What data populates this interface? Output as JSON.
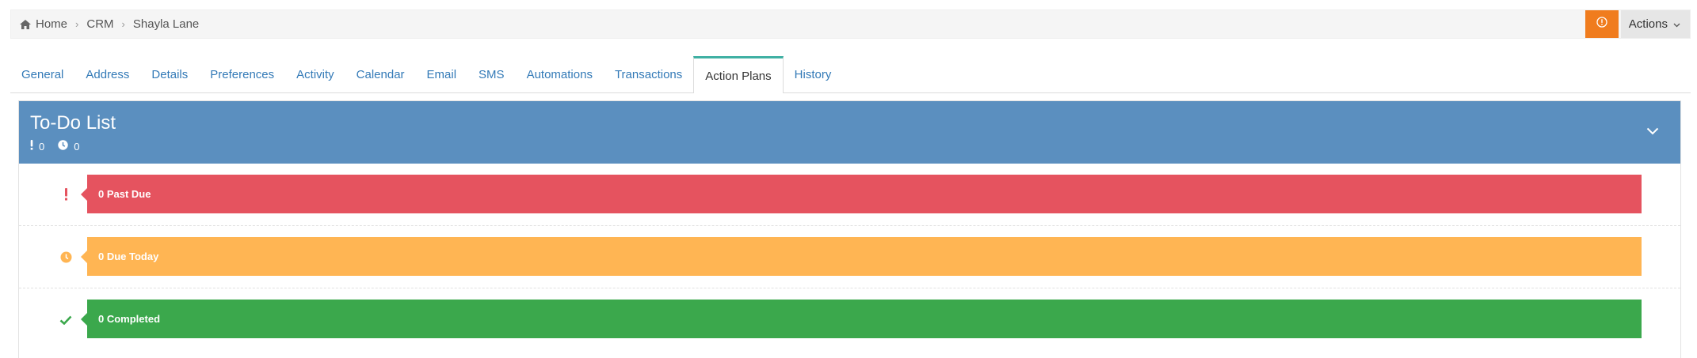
{
  "breadcrumb": {
    "home": "Home",
    "crm": "CRM",
    "current": "Shayla Lane"
  },
  "header": {
    "actions_label": "Actions"
  },
  "tabs": [
    {
      "label": "General"
    },
    {
      "label": "Address"
    },
    {
      "label": "Details"
    },
    {
      "label": "Preferences"
    },
    {
      "label": "Activity"
    },
    {
      "label": "Calendar"
    },
    {
      "label": "Email"
    },
    {
      "label": "SMS"
    },
    {
      "label": "Automations"
    },
    {
      "label": "Transactions"
    },
    {
      "label": "Action Plans",
      "active": true
    },
    {
      "label": "History"
    }
  ],
  "todo": {
    "title": "To-Do List",
    "past_due_count": "0",
    "due_today_count": "0",
    "rows": {
      "past_due": "0 Past Due",
      "due_today": "0 Due Today",
      "completed": "0 Completed"
    }
  },
  "colors": {
    "header_blue": "#5b8fbf",
    "past_due_red": "#e5535f",
    "due_today_orange": "#ffb553",
    "completed_green": "#3ba84c",
    "alert_orange": "#f07c1e",
    "tab_active_border": "#3fb0a3",
    "link_blue": "#337ab7"
  },
  "icons": {
    "home": "home-icon",
    "alert": "info-circle-icon",
    "chevron": "chevron-down-icon",
    "exclamation": "exclamation-icon",
    "clock": "clock-icon",
    "check": "check-icon"
  }
}
